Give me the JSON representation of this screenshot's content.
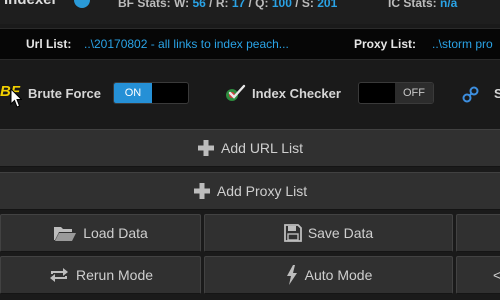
{
  "header": {
    "app_name": "Indexer",
    "stats_bf_label": "BF Stats: W: ",
    "stats_bf_w": "56",
    "stats_bf_sep1": " / R: ",
    "stats_bf_r": "17",
    "stats_bf_sep2": " / Q: ",
    "stats_bf_q": "100",
    "stats_bf_sep3": " / S: ",
    "stats_bf_s": "201",
    "stats_ic_label": "IC Stats: ",
    "stats_ic_val": "n/a"
  },
  "paths": {
    "url_label": "Url List:",
    "url_value": "..\\20170802 - all links to index peach...",
    "proxy_label": "Proxy List:",
    "proxy_value": "..\\storm pro"
  },
  "toggles": {
    "bf_logo": "BF",
    "brute_force_label": "Brute Force",
    "brute_force_state": "ON",
    "index_checker_label": "Index Checker",
    "index_checker_state": "OFF",
    "third_label_partial": "S"
  },
  "buttons": {
    "add_url_list": "Add URL List",
    "add_proxy_list": "Add Proxy List",
    "load_data": "Load Data",
    "save_data": "Save Data",
    "rerun_mode": "Rerun Mode",
    "auto_mode": "Auto Mode",
    "partial_chevron": "<"
  },
  "colors": {
    "accent_blue": "#2aa3e6",
    "toggle_on": "#2590d6",
    "bf_logo": "#f2d000",
    "button_bg": "#303030"
  },
  "icons": {
    "globe": "globe-icon",
    "cursor": "mouse-cursor-icon",
    "check": "index-check-icon",
    "link": "link-icon",
    "plus": "plus-icon",
    "folder": "folder-open-icon",
    "save": "save-disk-icon",
    "rerun": "rerun-arrows-icon",
    "bolt": "lightning-bolt-icon"
  }
}
